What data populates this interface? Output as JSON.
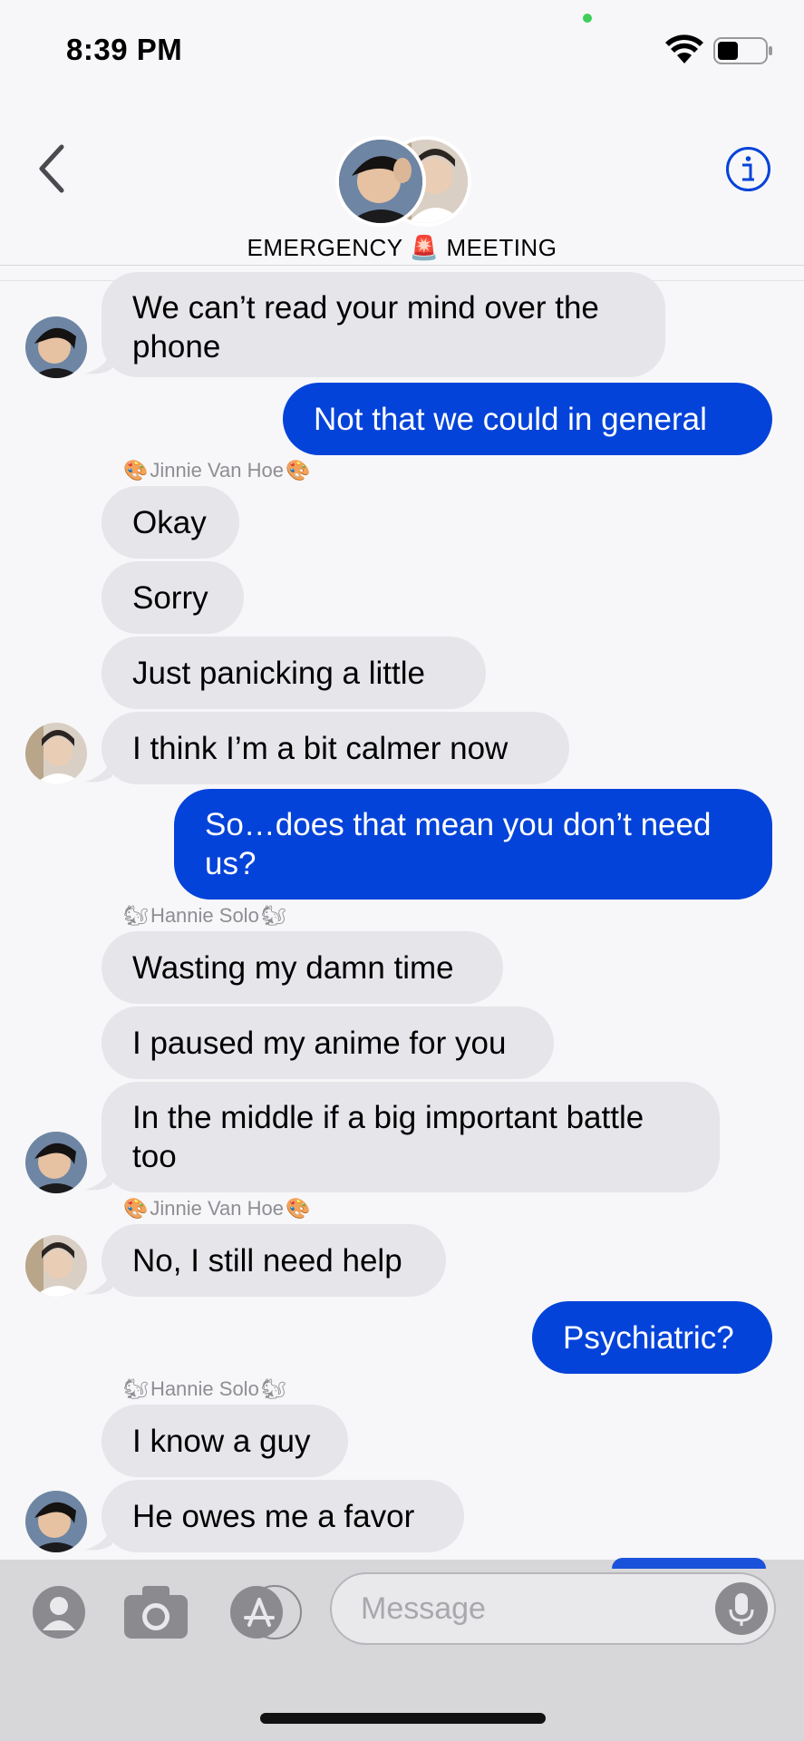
{
  "status": {
    "time": "8:39 PM"
  },
  "header": {
    "title": "EMERGENCY 🚨 MEETING",
    "back": "back",
    "info": "info"
  },
  "messages": [
    {
      "type": "in",
      "text_lines": [
        "We can’t read your mind over the",
        "phone"
      ]
    },
    {
      "type": "out",
      "text": "Not that we could in general"
    },
    {
      "type": "sender",
      "name": "Jinnie Van Hoe",
      "emoji": "🎨"
    },
    {
      "type": "in",
      "text": "Okay"
    },
    {
      "type": "in",
      "text": "Sorry"
    },
    {
      "type": "in",
      "text": "Just panicking a little"
    },
    {
      "type": "in",
      "text": "I think I’m a bit calmer now"
    },
    {
      "type": "out",
      "text_lines": [
        "So…does that mean you don’t need",
        "us?"
      ]
    },
    {
      "type": "sender",
      "name": "Hannie Solo",
      "emoji": "🐿"
    },
    {
      "type": "in",
      "text": "Wasting my damn time"
    },
    {
      "type": "in",
      "text": "I paused my anime for you"
    },
    {
      "type": "in",
      "text_lines": [
        "In the middle if a big important battle",
        "too"
      ]
    },
    {
      "type": "sender",
      "name": "Jinnie Van Hoe",
      "emoji": "🎨"
    },
    {
      "type": "in",
      "text": "No, I still need help"
    },
    {
      "type": "out",
      "text": "Psychiatric?"
    },
    {
      "type": "sender",
      "name": "Hannie Solo",
      "emoji": "🐿"
    },
    {
      "type": "in",
      "text": "I know a guy"
    },
    {
      "type": "in",
      "text": "He owes me a favor"
    }
  ],
  "composer": {
    "placeholder": "Message"
  },
  "colors": {
    "outgoing": "#0443d9",
    "incoming": "#e5e5ea",
    "accent": "#0443d9"
  }
}
